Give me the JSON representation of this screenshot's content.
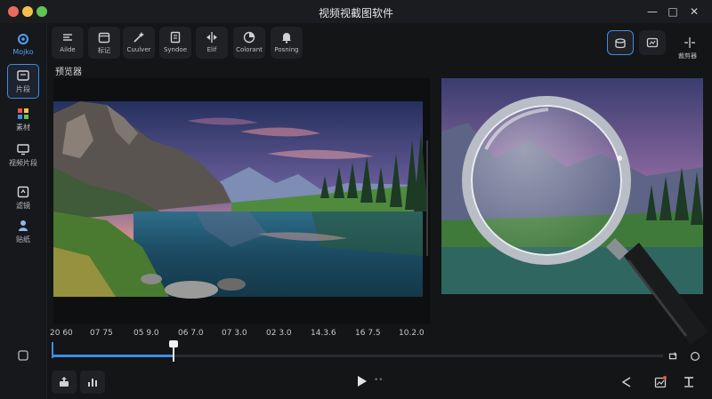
{
  "window": {
    "title": "视频视截图软件"
  },
  "sidebar": {
    "items": [
      {
        "label": "Mojko",
        "icon": "gear-icon"
      },
      {
        "label": "片段",
        "icon": "clip-icon"
      },
      {
        "label": "素材",
        "icon": "grid-icon"
      },
      {
        "label": "视频片段",
        "icon": "monitor-icon"
      },
      {
        "label": "滤镜",
        "icon": "frame-icon"
      },
      {
        "label": "贴纸",
        "icon": "users-icon"
      }
    ]
  },
  "toolbar": {
    "tools": [
      {
        "label": "Ailde",
        "icon": "align-icon"
      },
      {
        "label": "标记",
        "icon": "calendar-icon"
      },
      {
        "label": "Cuulver",
        "icon": "wand-icon"
      },
      {
        "label": "Syndoe",
        "icon": "doc-icon"
      },
      {
        "label": "Elif",
        "icon": "split-icon"
      },
      {
        "label": "Colorant",
        "icon": "color-wheel-icon"
      },
      {
        "label": "Posning",
        "icon": "bell-icon"
      }
    ],
    "right_label": "裁剪器"
  },
  "preview": {
    "section_label": "预览器"
  },
  "timeline": {
    "ticks": [
      "20 60",
      "07 75",
      "05 9.0",
      "06 7.0",
      "07 3.0",
      "02 3.0",
      "14.3.6",
      "16 7.5",
      "10.2.0"
    ],
    "progress": 0.195
  },
  "colors": {
    "accent": "#3a8ee6",
    "background": "#141517",
    "panel": "#202125"
  }
}
